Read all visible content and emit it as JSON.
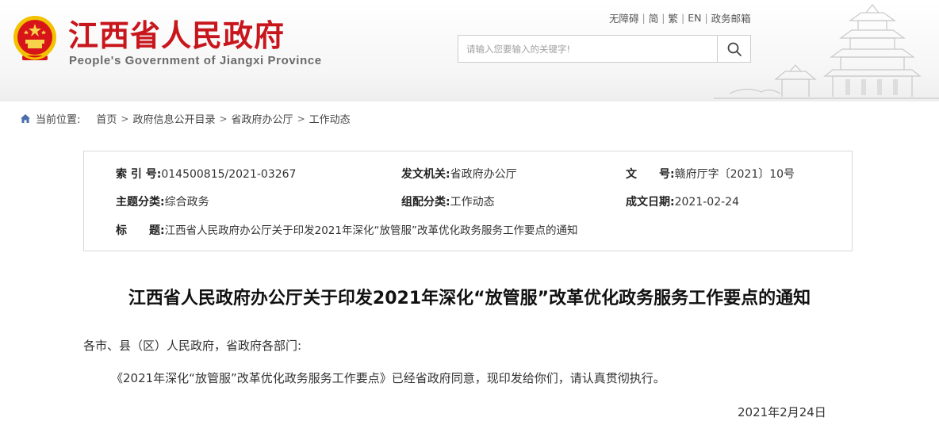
{
  "header": {
    "site_title": "江西省人民政府",
    "site_subtitle": "People's Government of Jiangxi Province",
    "top_links": [
      "无障碍",
      "简",
      "繁",
      "EN",
      "政务邮箱"
    ],
    "search_placeholder": "请输入您要输入的关键字!"
  },
  "breadcrumb": {
    "label": "当前位置:",
    "items": [
      "首页",
      "政府信息公开目录",
      "省政府办公厅",
      "工作动态"
    ]
  },
  "info": {
    "index_no_label": "索 引 号:",
    "index_no": "014500815/2021-03267",
    "issuer_label": "发文机关:",
    "issuer": "省政府办公厅",
    "doc_no_label": "文　　号:",
    "doc_no": "赣府厅字〔2021〕10号",
    "topic_label": "主题分类:",
    "topic": "综合政务",
    "category_label": "组配分类:",
    "category": "工作动态",
    "date_label": "成文日期:",
    "date": "2021-02-24",
    "title_label": "标　　题:",
    "title": "江西省人民政府办公厅关于印发2021年深化“放管服”改革优化政务服务工作要点的通知"
  },
  "document": {
    "title": "江西省人民政府办公厅关于印发2021年深化“放管服”改革优化政务服务工作要点的通知",
    "salutation": "各市、县（区）人民政府，省政府各部门:",
    "paragraph": "《2021年深化“放管服”改革优化政务服务工作要点》已经省政府同意，现印发给你们，请认真贯彻执行。",
    "date": "2021年2月24日"
  },
  "colors": {
    "brand_red": "#c8161d",
    "emblem_gold": "#f2c200"
  }
}
